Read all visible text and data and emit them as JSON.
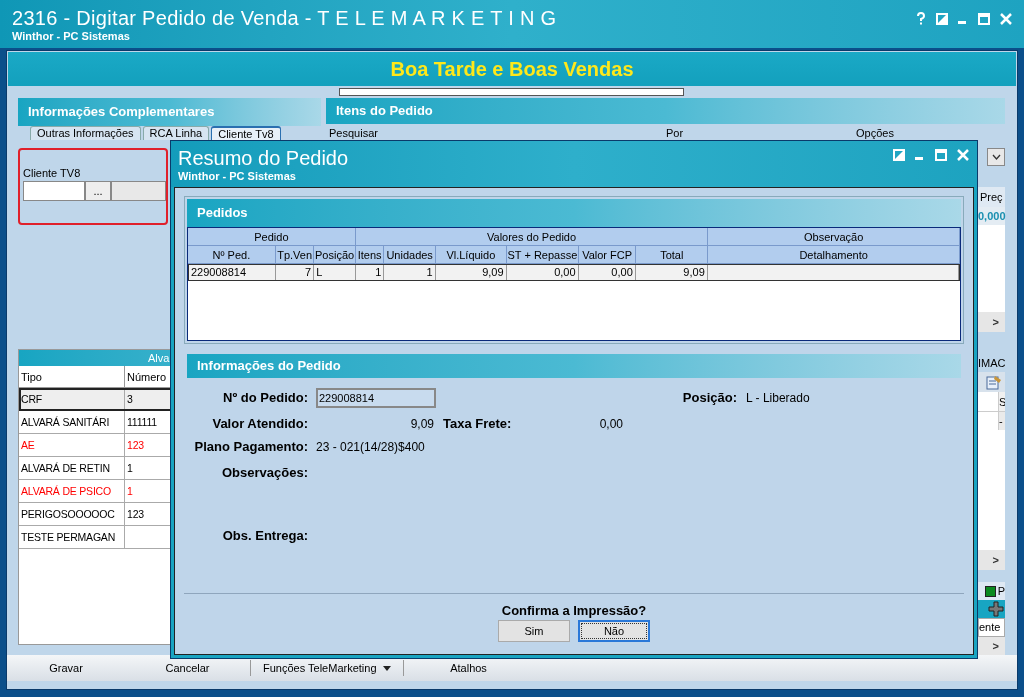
{
  "window": {
    "title": "2316 - Digitar Pedido de Venda - T E L E M A R K E T I N G",
    "subtitle": "Winthor - PC Sistemas"
  },
  "banner": "Boa Tarde e Boas Vendas",
  "left": {
    "header": "Informações Complementares",
    "tabs": [
      {
        "label": "Outras Informações",
        "selected": false
      },
      {
        "label": "RCA Linha",
        "selected": false
      },
      {
        "label": "Cliente Tv8",
        "selected": true
      }
    ],
    "cliente": {
      "label": "Cliente TV8",
      "button": "..."
    },
    "alvaras": {
      "header": "Alva",
      "columns": [
        "Tipo",
        "Número"
      ],
      "rows": [
        {
          "cells": [
            "CRF",
            "3"
          ],
          "selected": true,
          "color": "#000000"
        },
        {
          "cells": [
            "ALVARÁ SANITÁRI",
            "111111"
          ],
          "selected": false,
          "color": "#000000"
        },
        {
          "cells": [
            "AE",
            "123"
          ],
          "selected": false,
          "color": "#ff0000"
        },
        {
          "cells": [
            "ALVARÁ DE RETIN",
            "1"
          ],
          "selected": false,
          "color": "#000000"
        },
        {
          "cells": [
            "ALVARÁ DE PSICO",
            "1"
          ],
          "selected": false,
          "color": "#ff0000"
        },
        {
          "cells": [
            "PERIGOSOOOOOC",
            "123"
          ],
          "selected": false,
          "color": "#000000"
        },
        {
          "cells": [
            "TESTE PERMAGAN",
            ""
          ],
          "selected": false,
          "color": "#000000"
        }
      ]
    }
  },
  "right": {
    "header": "Itens do Pedido",
    "labels": [
      "Pesquisar",
      "Por",
      "Opções"
    ],
    "strip": {
      "column_header": "Preç",
      "cell": "0,000",
      "arrow_1": ">",
      "label": "IMAC",
      "column_header_2": "S",
      "cell_2": "-",
      "arrow_2": ">",
      "legend": "P",
      "cell_3": "ente",
      "arrow_3": ">"
    }
  },
  "toolbar": [
    {
      "label": "Gravar",
      "kind": "button"
    },
    {
      "label": "Cancelar",
      "kind": "button"
    },
    {
      "label": "Funções TeleMarketing",
      "kind": "dropdown"
    },
    {
      "label": "Atalhos",
      "kind": "button"
    }
  ],
  "dialog": {
    "title": "Resumo do Pedido",
    "subtitle": "Winthor - PC Sistemas",
    "pedidos": {
      "header": "Pedidos",
      "groups": [
        {
          "label": "Pedido",
          "columns": [
            "Nº Ped.",
            "Tp.Ven",
            "Posição"
          ]
        },
        {
          "label": "Valores do Pedido",
          "columns": [
            "Itens",
            "Unidades",
            "Vl.Líquido",
            "ST + Repasse",
            "Valor FCP",
            "Total"
          ]
        },
        {
          "label": "Observação",
          "columns": [
            "Detalhamento"
          ]
        }
      ],
      "rows": [
        [
          "229008814",
          "7",
          "L",
          "1",
          "1",
          "9,09",
          "0,00",
          "0,00",
          "9,09",
          ""
        ]
      ]
    },
    "info": {
      "header": "Informações do Pedido",
      "numero": {
        "label": "Nº do Pedido:",
        "value": "229008814"
      },
      "posicao": {
        "label": "Posição:",
        "value": "L - Liberado"
      },
      "valor": {
        "label": "Valor Atendido:",
        "value": "9,09"
      },
      "frete": {
        "label": "Taxa Frete:",
        "value": "0,00"
      },
      "plano": {
        "label": "Plano Pagamento:",
        "value": "23 - 021(14/28)$400"
      },
      "obs": {
        "label": "Observações:"
      },
      "entrega": {
        "label": "Obs. Entrega:"
      }
    },
    "confirm": {
      "question": "Confirma a Impressão?",
      "buttons": [
        {
          "label": "Sim",
          "selected": false
        },
        {
          "label": "Não",
          "selected": true
        }
      ]
    }
  }
}
